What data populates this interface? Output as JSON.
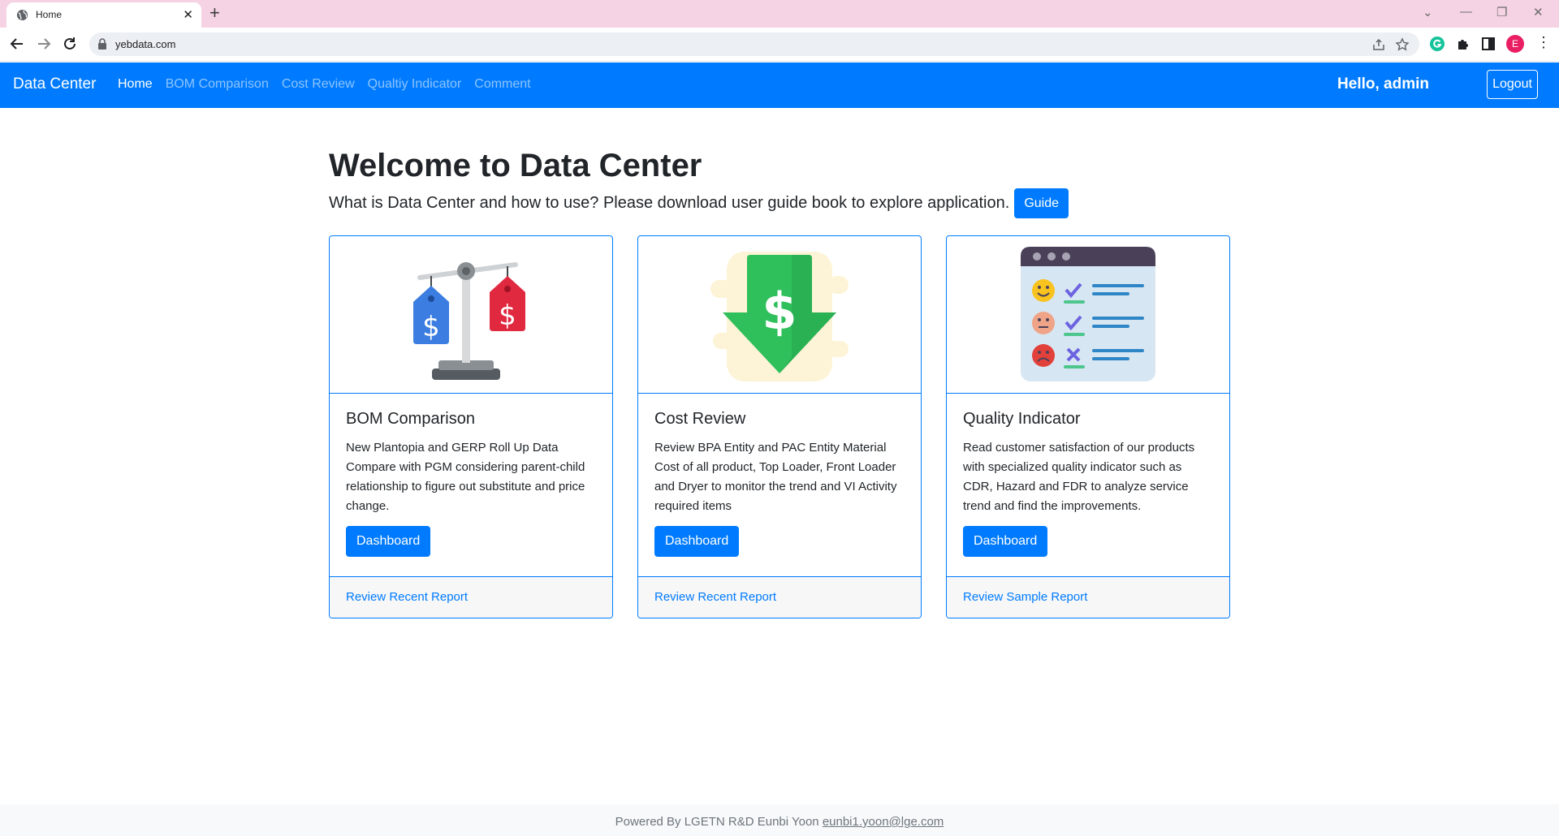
{
  "browser": {
    "tab_title": "Home",
    "url": "yebdata.com",
    "profile_initial": "E"
  },
  "navbar": {
    "brand": "Data Center",
    "links": [
      "Home",
      "BOM Comparison",
      "Cost Review",
      "Qualtiy Indicator",
      "Comment"
    ],
    "greeting": "Hello, admin",
    "logout": "Logout"
  },
  "hero": {
    "title": "Welcome to Data Center",
    "lead": "What is Data Center and how to use? Please download user guide book to explore application.",
    "guide_button": "Guide"
  },
  "cards": [
    {
      "title": "BOM Comparison",
      "text": "New Plantopia and GERP Roll Up Data Compare with PGM considering parent-child relationship to figure out substitute and price change.",
      "button": "Dashboard",
      "footer_link": "Review Recent Report",
      "icon": "price-scale-icon"
    },
    {
      "title": "Cost Review",
      "text": "Review BPA Entity and PAC Entity Material Cost of all product, Top Loader, Front Loader and Dryer to monitor the trend and VI Activity required items",
      "button": "Dashboard",
      "footer_link": "Review Recent Report",
      "icon": "dollar-down-arrow-icon"
    },
    {
      "title": "Quality Indicator",
      "text": "Read customer satisfaction of our products with specialized quality indicator such as CDR, Hazard and FDR to analyze service trend and find the improvements.",
      "button": "Dashboard",
      "footer_link": "Review Sample Report",
      "icon": "satisfaction-survey-icon"
    }
  ],
  "footer": {
    "text": "Powered By LGETN R&D Eunbi Yoon ",
    "email": "eunbi1.yoon@lge.com"
  },
  "colors": {
    "primary": "#007bff",
    "tabstrip": "#f6d3e4"
  }
}
